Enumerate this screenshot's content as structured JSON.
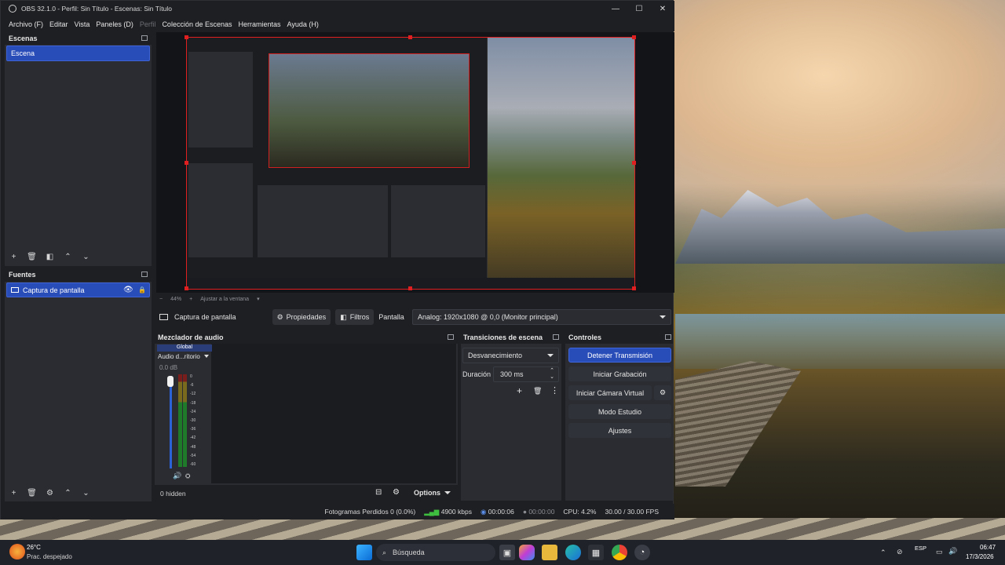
{
  "window": {
    "title": "OBS 32.1.0 - Perfil: Sin Título - Escenas: Sin Título",
    "minimize": "—",
    "maximize": "☐",
    "close": "✕"
  },
  "menu": [
    "Archivo (F)",
    "Editar",
    "Vista",
    "Paneles (D)",
    "Perfil",
    "Colección de Escenas",
    "Herramientas",
    "Ayuda (H)"
  ],
  "scenes": {
    "title": "Escenas",
    "items": [
      "Escena"
    ]
  },
  "sources": {
    "title": "Fuentes",
    "items": [
      "Captura de pantalla"
    ]
  },
  "preview": {
    "zoom": "44%",
    "fit_label": "Ajustar a la ventana"
  },
  "source_toolbar": {
    "source_name": "Captura de pantalla",
    "properties": "Propiedades",
    "filters": "Filtros",
    "display_label": "Pantalla",
    "display_value": "Analog: 1920x1080 @ 0,0 (Monitor principal)"
  },
  "mixer": {
    "title": "Mezclador de audio",
    "channel_tag": "Global",
    "channel_name": "Audio d...ritorio",
    "level": "0.0 dB",
    "ticks": [
      "0",
      "-6",
      "-12",
      "-18",
      "-24",
      "-30",
      "-36",
      "-42",
      "-48",
      "-54",
      "-60"
    ],
    "hidden": "0 hidden",
    "options": "Options"
  },
  "transitions": {
    "title": "Transiciones de escena",
    "selected": "Desvanecimiento",
    "duration_label": "Duración",
    "duration_value": "300 ms"
  },
  "controls": {
    "title": "Controles",
    "stop_stream": "Detener Transmisión",
    "start_recording": "Iniciar Grabación",
    "start_virtual_cam": "Iniciar Cámara Virtual",
    "studio_mode": "Modo Estudio",
    "settings": "Ajustes"
  },
  "status": {
    "dropped": "Fotogramas Perdidos 0 (0.0%)",
    "bitrate": "4900 kbps",
    "stream_time": "00:00:06",
    "rec_time": "00:00:00",
    "cpu": "CPU: 4.2%",
    "fps": "30.00 / 30.00 FPS"
  },
  "taskbar": {
    "temp": "26°C",
    "weather": "Prac. despejado",
    "search": "Búsqueda",
    "lang": "ESP",
    "time": "06:47",
    "date": "17/3/2026"
  },
  "colors": {
    "accent": "#284cb8",
    "recording_outline": "#e02020",
    "bitrate_ok": "#3fbf3f"
  }
}
